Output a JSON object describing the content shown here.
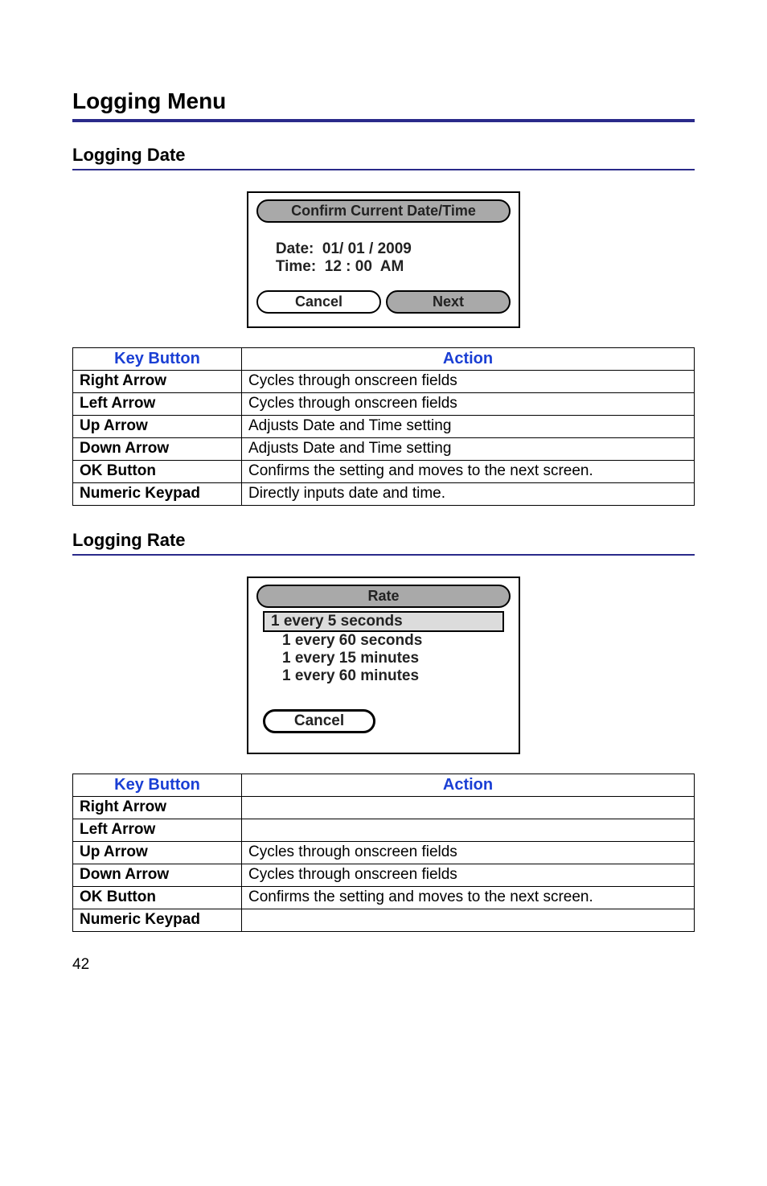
{
  "section_title": "Logging Menu",
  "sub1_title": "Logging Date",
  "panel1": {
    "title": "Confirm Current Date/Time",
    "date_label": "Date:",
    "date_value": "01/ 01 / 2009",
    "time_label": "Time:",
    "time_value": "12 : 00  AM",
    "cancel_label": "Cancel",
    "next_label": "Next"
  },
  "table1": {
    "head_key": "Key Button",
    "head_action": "Action",
    "rows": [
      {
        "key": "Right Arrow",
        "action": "Cycles through onscreen fields"
      },
      {
        "key": "Left Arrow",
        "action": "Cycles through onscreen fields"
      },
      {
        "key": "Up Arrow",
        "action": "Adjusts Date and Time setting"
      },
      {
        "key": "Down Arrow",
        "action": "Adjusts Date and Time setting"
      },
      {
        "key": "OK Button",
        "action": "Confirms the setting and moves to the next screen."
      },
      {
        "key": "Numeric Keypad",
        "action": "Directly inputs date and time."
      }
    ]
  },
  "sub2_title": "Logging Rate",
  "panel2": {
    "title": "Rate",
    "items": [
      "1 every 5 seconds",
      "1 every 60 seconds",
      "1 every 15 minutes",
      "1 every 60 minutes"
    ],
    "cancel_label": "Cancel"
  },
  "table2": {
    "head_key": "Key Button",
    "head_action": "Action",
    "rows": [
      {
        "key": "Right Arrow",
        "action": ""
      },
      {
        "key": "Left Arrow",
        "action": ""
      },
      {
        "key": "Up Arrow",
        "action": "Cycles through onscreen fields"
      },
      {
        "key": "Down Arrow",
        "action": "Cycles through onscreen fields"
      },
      {
        "key": "OK Button",
        "action": "Confirms the setting and moves to the next screen."
      },
      {
        "key": "Numeric Keypad",
        "action": ""
      }
    ]
  },
  "page_number": "42"
}
